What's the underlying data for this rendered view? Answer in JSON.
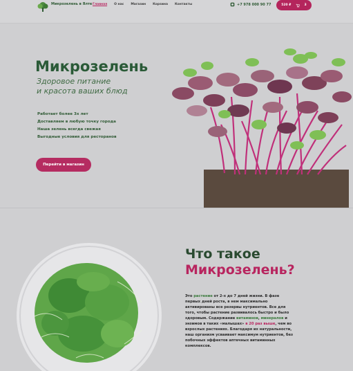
{
  "header": {
    "logo_text": "Микрозелень в Ялте",
    "nav": [
      {
        "label": "Главная",
        "active": true
      },
      {
        "label": "О нас",
        "active": false
      },
      {
        "label": "Магазин",
        "active": false
      },
      {
        "label": "Корзина",
        "active": false
      },
      {
        "label": "Контакты",
        "active": false
      }
    ],
    "phone": "+7 978 000 90 77",
    "cart_total": "520 ₽",
    "cart_count": "3"
  },
  "hero": {
    "title": "Микрозелень",
    "subtitle_line1": "Здоровое питание",
    "subtitle_line2": "и красота ваших блюд",
    "features": [
      "Работает более 3х лет",
      "Доставляем в любую точку города",
      "Наша зелень всегда свежая",
      "Выгодные условия для ресторанов"
    ],
    "button": "Перейти в магазин"
  },
  "about": {
    "title_line1": "Что такое",
    "title_line2": "Микрозелень?",
    "desc": {
      "t1": "Это ",
      "t2": "растение",
      "t3": " от 2-х до 7 дней жизни. В фазе первых дней роста, в нем максимально активированы все резервы нутриентов. Все для того, чтобы растение развивалось быстро и было здоровым. Содержание ",
      "t4": "витаминов",
      "t5": ", ",
      "t6": "минералов",
      "t7": " и энзимов в таких «малышах» ",
      "t8": "в 20 раз выше",
      "t9": ", чем во взрослых растениях. Благодаря их натуральности, наш организм усваивает максимум нутриентов, без побочных эффектов аптечных витаминных комплексов."
    }
  },
  "colors": {
    "brand_green": "#2a5a37",
    "accent_pink": "#b52c61",
    "background": "#cfcfd1"
  },
  "icons": [
    "leaf-logo-icon",
    "phone-icon",
    "cart-icon"
  ]
}
